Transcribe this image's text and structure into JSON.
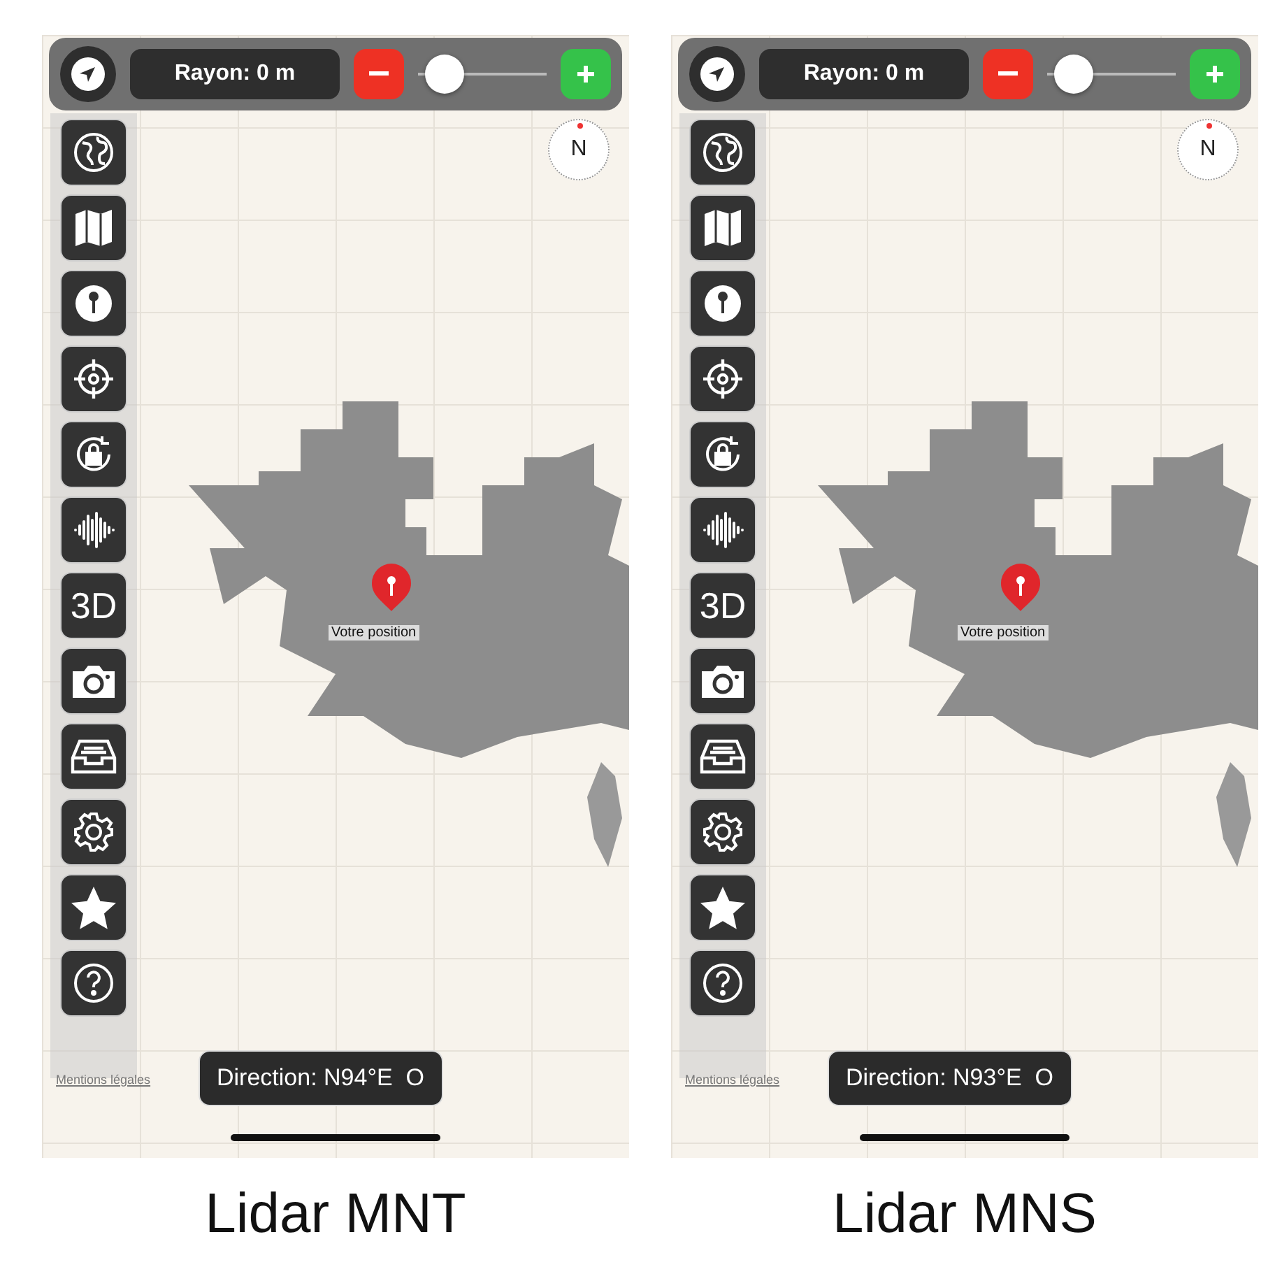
{
  "panels": [
    {
      "radius": {
        "label": "Rayon: 0 m"
      },
      "zoom_slider": {
        "level": 0.08
      },
      "compass": {
        "label": "N"
      },
      "sidebar": [
        {
          "kind": "globe"
        },
        {
          "kind": "map"
        },
        {
          "kind": "pin"
        },
        {
          "kind": "crosshair"
        },
        {
          "kind": "rotation-lock"
        },
        {
          "kind": "waveform"
        },
        {
          "kind": "text",
          "label": "3D"
        },
        {
          "kind": "camera"
        },
        {
          "kind": "inbox"
        },
        {
          "kind": "gear"
        },
        {
          "kind": "star"
        },
        {
          "kind": "help"
        }
      ],
      "pin_label": "Votre position",
      "legal_link": "Mentions légales",
      "direction": "Direction: N94°E  O",
      "caption": "Lidar MNT"
    },
    {
      "radius": {
        "label": "Rayon: 0 m"
      },
      "zoom_slider": {
        "level": 0.08
      },
      "compass": {
        "label": "N"
      },
      "sidebar": [
        {
          "kind": "globe"
        },
        {
          "kind": "map"
        },
        {
          "kind": "pin"
        },
        {
          "kind": "crosshair"
        },
        {
          "kind": "rotation-lock"
        },
        {
          "kind": "waveform"
        },
        {
          "kind": "text",
          "label": "3D"
        },
        {
          "kind": "camera"
        },
        {
          "kind": "inbox"
        },
        {
          "kind": "gear"
        },
        {
          "kind": "star"
        },
        {
          "kind": "help"
        }
      ],
      "pin_label": "Votre position",
      "legal_link": "Mentions légales",
      "direction": "Direction: N93°E  O",
      "caption": "Lidar MNS"
    }
  ]
}
